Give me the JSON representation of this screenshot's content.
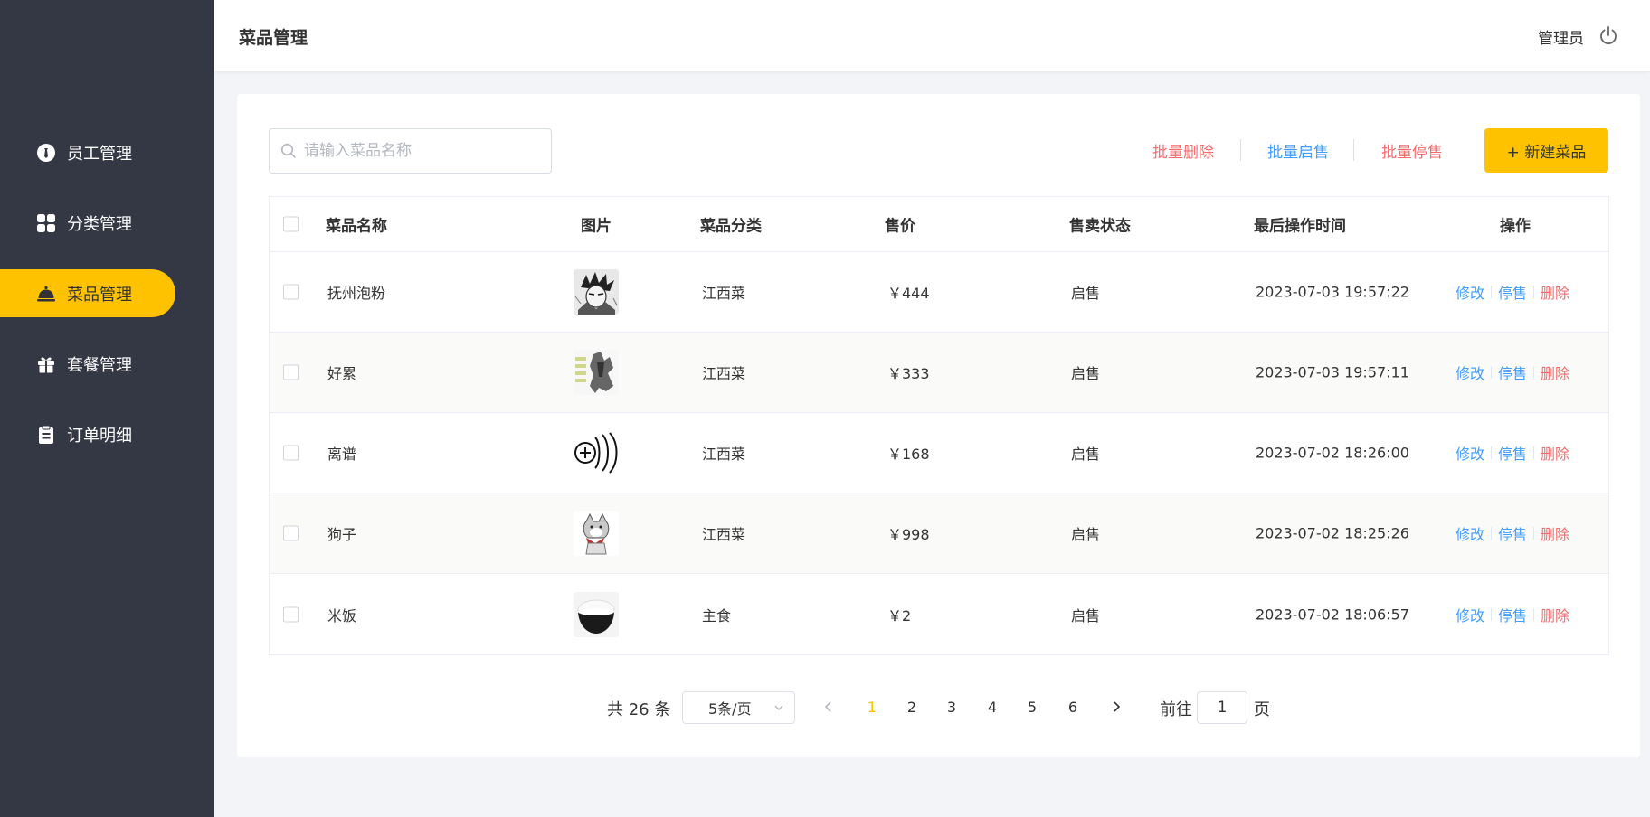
{
  "sidebar": {
    "items": [
      {
        "label": "员工管理",
        "icon": "employee-icon"
      },
      {
        "label": "分类管理",
        "icon": "category-icon"
      },
      {
        "label": "菜品管理",
        "icon": "dish-bell-icon"
      },
      {
        "label": "套餐管理",
        "icon": "gift-icon"
      },
      {
        "label": "订单明细",
        "icon": "clipboard-icon"
      }
    ],
    "active_index": 2
  },
  "header": {
    "title": "菜品管理",
    "user": "管理员"
  },
  "toolbar": {
    "search_placeholder": "请输入菜品名称",
    "batch_delete": "批量删除",
    "batch_start": "批量启售",
    "batch_stop": "批量停售",
    "new_dish": "+ 新建菜品"
  },
  "table": {
    "columns": [
      "菜品名称",
      "图片",
      "菜品分类",
      "售价",
      "售卖状态",
      "最后操作时间",
      "操作"
    ],
    "rows": [
      {
        "name": "抚州泡粉",
        "image": "manga-portrait",
        "category": "江西菜",
        "price": "￥444",
        "status": "启售",
        "updated": "2023-07-03 19:57:22"
      },
      {
        "name": "好累",
        "image": "meme-tired",
        "category": "江西菜",
        "price": "￥333",
        "status": "启售",
        "updated": "2023-07-03 19:57:11"
      },
      {
        "name": "离谱",
        "image": "meme-321",
        "category": "江西菜",
        "price": "￥168",
        "status": "启售",
        "updated": "2023-07-02 18:26:00"
      },
      {
        "name": "狗子",
        "image": "cartoon-dog",
        "category": "江西菜",
        "price": "￥998",
        "status": "启售",
        "updated": "2023-07-02 18:25:26"
      },
      {
        "name": "米饭",
        "image": "rice-bowl",
        "category": "主食",
        "price": "￥2",
        "status": "启售",
        "updated": "2023-07-02 18:06:57"
      }
    ],
    "actions": {
      "edit": "修改",
      "stop": "停售",
      "delete": "删除"
    }
  },
  "pagination": {
    "total_label": "共 26 条",
    "page_size": "5条/页",
    "pages": [
      "1",
      "2",
      "3",
      "4",
      "5",
      "6"
    ],
    "current": "1",
    "goto_label": "前往",
    "goto_value": "1",
    "goto_suffix": "页"
  },
  "colors": {
    "sidebar_bg": "#343744",
    "accent": "#ffc200",
    "link_blue": "#409eff",
    "danger_red": "#f56c6c"
  }
}
